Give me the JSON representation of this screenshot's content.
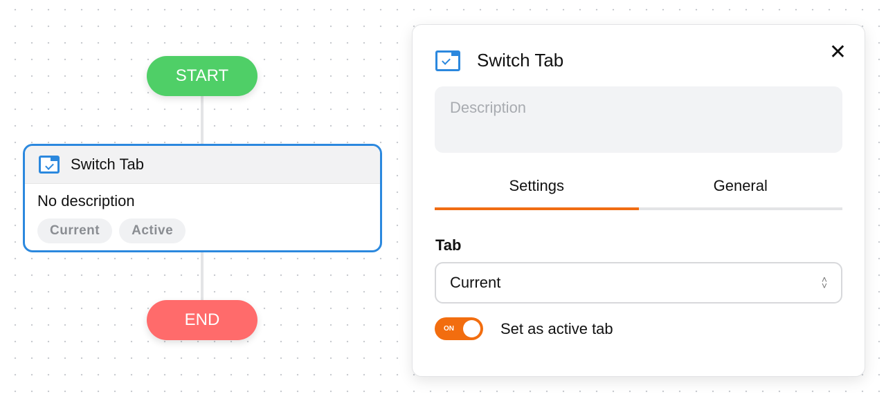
{
  "flow": {
    "start_label": "START",
    "end_label": "END",
    "node": {
      "title": "Switch Tab",
      "description": "No description",
      "chips": [
        "Current",
        "Active"
      ],
      "icon": "switch-tab-icon"
    }
  },
  "panel": {
    "title": "Switch Tab",
    "icon": "switch-tab-icon",
    "close_icon": "close-icon",
    "description_placeholder": "Description",
    "tabs": [
      {
        "label": "Settings",
        "active": true
      },
      {
        "label": "General",
        "active": false
      }
    ],
    "tab_field_label": "Tab",
    "tab_select_value": "Current",
    "toggle": {
      "state_text": "ON",
      "on": true,
      "label": "Set as active tab"
    }
  },
  "colors": {
    "start": "#4fcf67",
    "end": "#ff6b6b",
    "accent": "#f26d0f",
    "node_border": "#2b88de"
  }
}
